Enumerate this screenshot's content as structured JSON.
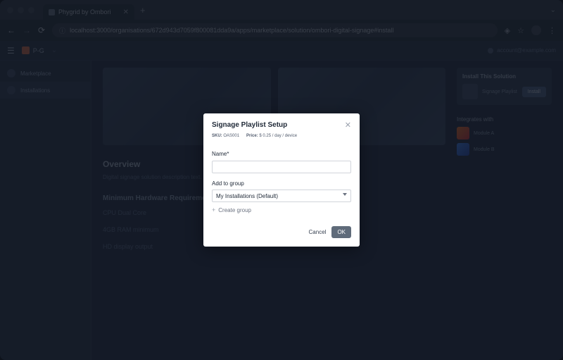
{
  "browser": {
    "tab_title": "Phygrid by Ombori",
    "url": "localhost:3000/organisations/672d943d7059f800081dda9a/apps/marketplace/solution/ombori-digital-signage#install"
  },
  "app": {
    "brand": "P-G",
    "user_label": "account@example.com"
  },
  "sidebar": {
    "items": [
      {
        "label": "Marketplace"
      },
      {
        "label": "Installations"
      }
    ]
  },
  "page": {
    "overview_title": "Overview",
    "overview_body": "Digital signage solution description text.",
    "hw_title": "Minimum Hardware Requirements",
    "reqs": [
      "CPU Dual Core",
      "4GB RAM minimum",
      "HD display output"
    ]
  },
  "right": {
    "install_title": "Install This Solution",
    "install_label": "Signage Playlist",
    "install_button": "Install",
    "integrates_title": "Integrates with",
    "integrations": [
      {
        "label": "Module A"
      },
      {
        "label": "Module B"
      }
    ]
  },
  "modal": {
    "title": "Signage Playlist Setup",
    "sku_label": "SKU:",
    "sku_value": "OAS001",
    "price_label": "Price:",
    "price_value": "$ 0.25 / day / device",
    "name_label": "Name*",
    "name_value": "",
    "group_label": "Add to group",
    "group_selected": "My Installations (Default)",
    "create_group": "Create group",
    "cancel": "Cancel",
    "ok": "OK"
  }
}
